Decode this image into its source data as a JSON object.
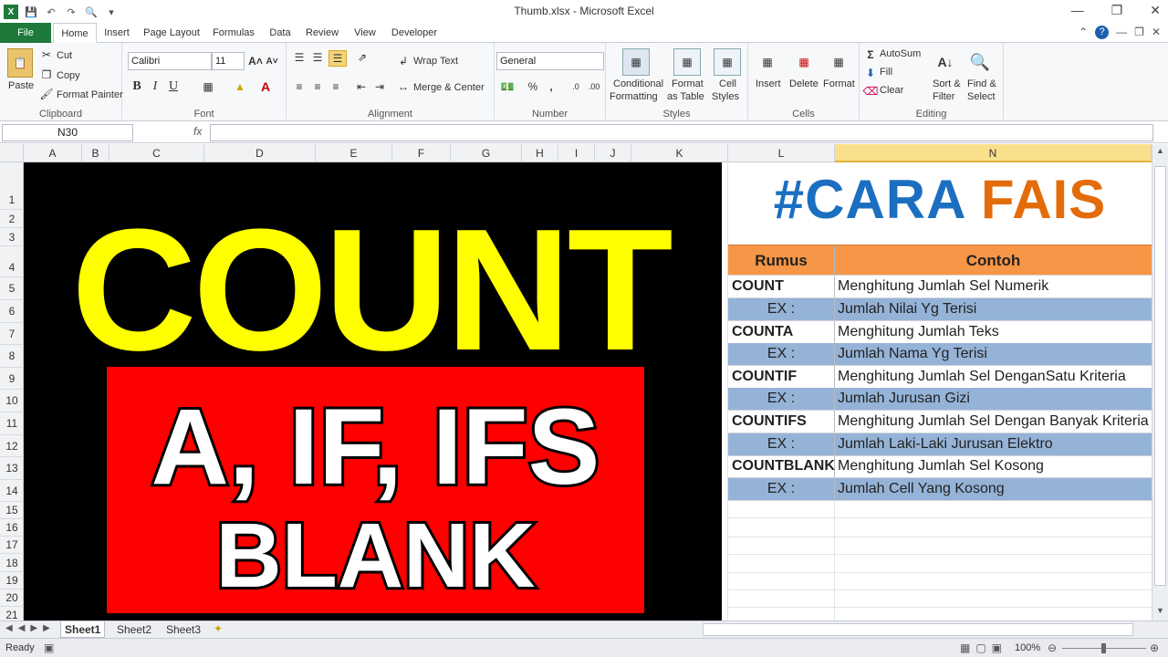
{
  "window": {
    "title": "Thumb.xlsx - Microsoft Excel"
  },
  "ribbon": {
    "tabs": [
      "File",
      "Home",
      "Insert",
      "Page Layout",
      "Formulas",
      "Data",
      "Review",
      "View",
      "Developer"
    ],
    "clipboard": {
      "paste": "Paste",
      "cut": "Cut",
      "copy": "Copy",
      "format_painter": "Format Painter",
      "label": "Clipboard"
    },
    "font": {
      "name": "Calibri",
      "size": "11",
      "label": "Font"
    },
    "alignment": {
      "wrap": "Wrap Text",
      "merge": "Merge & Center",
      "label": "Alignment"
    },
    "number": {
      "format": "General",
      "label": "Number"
    },
    "styles": {
      "cond1": "Conditional",
      "cond2": "Formatting",
      "fmt1": "Format",
      "fmt2": "as Table",
      "cell1": "Cell",
      "cell2": "Styles",
      "label": "Styles"
    },
    "cells": {
      "insert": "Insert",
      "delete": "Delete",
      "format": "Format",
      "label": "Cells"
    },
    "editing": {
      "autosum": "AutoSum",
      "fill": "Fill",
      "clear": "Clear",
      "sort1": "Sort &",
      "sort2": "Filter",
      "find1": "Find &",
      "find2": "Select",
      "label": "Editing"
    }
  },
  "formula_bar": {
    "name_box": "N30",
    "fx": "fx",
    "value": ""
  },
  "columns": [
    "A",
    "B",
    "C",
    "D",
    "E",
    "F",
    "G",
    "H",
    "I",
    "J",
    "K",
    "L",
    "N"
  ],
  "rows": [
    "1",
    "2",
    "3",
    "4",
    "5",
    "6",
    "7",
    "8",
    "9",
    "10",
    "11",
    "12",
    "13",
    "14",
    "15",
    "16",
    "17",
    "18",
    "19",
    "20",
    "21"
  ],
  "art": {
    "count": "COUNT",
    "line2": "A, IF, IFS",
    "line3": "BLANK",
    "cara_a": "#CARA",
    "cara_b": "FAIS"
  },
  "table": {
    "header": [
      "Rumus",
      "Contoh"
    ],
    "rows": [
      [
        "COUNT",
        "Menghitung Jumlah Sel Numerik"
      ],
      [
        "EX :",
        "Jumlah Nilai Yg Terisi"
      ],
      [
        "COUNTA",
        "Menghitung Jumlah Teks"
      ],
      [
        "EX :",
        "Jumlah Nama Yg Terisi"
      ],
      [
        "COUNTIF",
        "Menghitung Jumlah Sel DenganSatu Kriteria"
      ],
      [
        "EX :",
        "Jumlah Jurusan Gizi"
      ],
      [
        "COUNTIFS",
        "Menghitung Jumlah Sel Dengan Banyak Kriteria"
      ],
      [
        "EX :",
        "Jumlah Laki-Laki Jurusan Elektro"
      ],
      [
        "COUNTBLANK",
        "Menghitung Jumlah Sel Kosong"
      ],
      [
        "EX :",
        "Jumlah Cell Yang Kosong"
      ]
    ]
  },
  "sheets": [
    "Sheet1",
    "Sheet2",
    "Sheet3"
  ],
  "status": {
    "ready": "Ready",
    "zoom": "100%"
  },
  "colors": {
    "file_tab": "#1d7a3a",
    "header_orange": "#f79646",
    "row_blue": "#95b3d7",
    "count_yellow": "#ffff00",
    "box_red": "#ff0000",
    "cara_blue": "#1c6fc0",
    "fais_orange": "#e36c0a"
  }
}
